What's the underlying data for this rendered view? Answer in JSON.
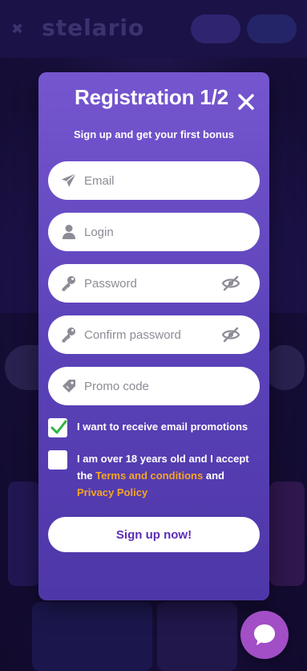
{
  "background": {
    "logo_text": "stelario"
  },
  "modal": {
    "title": "Registration 1/2",
    "subtitle": "Sign up and get your first bonus",
    "close_icon": "close-icon",
    "fields": {
      "email": {
        "placeholder": "Email",
        "icon": "paper-plane-icon"
      },
      "login": {
        "placeholder": "Login",
        "icon": "user-icon"
      },
      "password": {
        "placeholder": "Password",
        "icon": "key-icon",
        "toggle_icon": "eye-slash-icon"
      },
      "confirm_password": {
        "placeholder": "Confirm password",
        "icon": "key-icon",
        "toggle_icon": "eye-slash-icon"
      },
      "promo_code": {
        "placeholder": "Promo code",
        "icon": "tag-icon"
      }
    },
    "checkboxes": {
      "email_promotions": {
        "label": "I want to receive email promotions",
        "checked": true
      },
      "age_terms": {
        "text_before": "I am over 18 years old and I accept the ",
        "terms_link": "Terms and conditions",
        "text_and": " and ",
        "privacy_link": "Privacy Policy",
        "checked": false
      }
    },
    "submit_label": "Sign up now!"
  },
  "chat_button": {
    "icon": "chat-bubble-icon"
  },
  "colors": {
    "modal_top": "#7556cf",
    "modal_bottom": "#4e37a8",
    "accent_link": "#f5a524",
    "submit_text": "#5b2db7",
    "checkmark": "#2fb344",
    "chat_button": "#a24ec6"
  }
}
